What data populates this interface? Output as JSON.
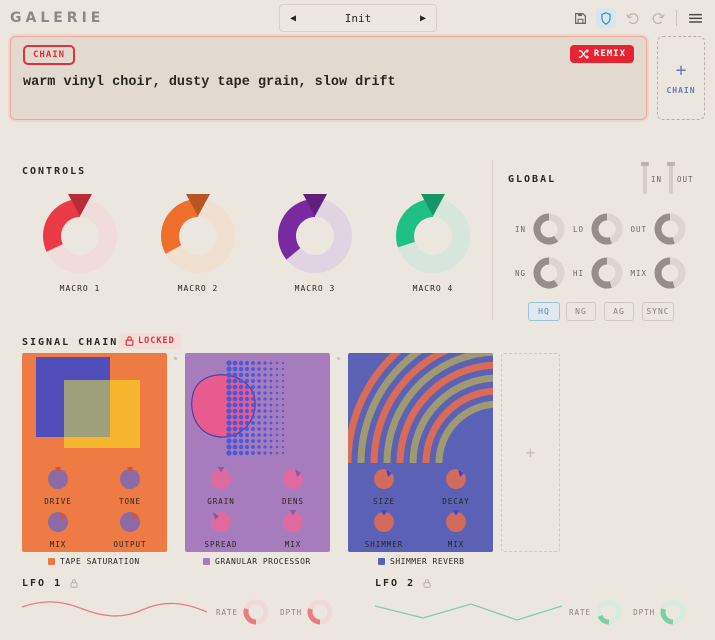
{
  "app": {
    "brand": "GALERIE"
  },
  "preset": {
    "name": "Init",
    "prev_icon": "triangle-left",
    "next_icon": "triangle-right"
  },
  "toolbar": {
    "icons": [
      "save-icon",
      "shield-icon",
      "undo-icon",
      "redo-icon",
      "menu-icon"
    ]
  },
  "prompt": {
    "tag": "CHAIN",
    "text": "warm vinyl choir, dusty tape grain, slow drift",
    "remix_label": "REMIX"
  },
  "add_chain": {
    "plus": "+",
    "label": "CHAIN"
  },
  "controls": {
    "title": "CONTROLS",
    "macros": [
      {
        "label": "MACRO 1",
        "value": 0.32,
        "color": "#ea3a47",
        "track": "#f0dcd8"
      },
      {
        "label": "MACRO 2",
        "value": 0.33,
        "color": "#ee6e2c",
        "track": "#f0e0d0"
      },
      {
        "label": "MACRO 3",
        "value": 0.36,
        "color": "#7a2aa0",
        "track": "#e0d4e2"
      },
      {
        "label": "MACRO 4",
        "value": 0.3,
        "color": "#1fbf86",
        "track": "#d6e6dc"
      }
    ]
  },
  "global": {
    "title": "GLOBAL",
    "fader_in": "IN",
    "fader_out": "OUT",
    "knobs": [
      {
        "label": "IN",
        "value": 0.6
      },
      {
        "label": "LO",
        "value": 0.55
      },
      {
        "label": "OUT",
        "value": 0.55
      },
      {
        "label": "NG",
        "value": 0.6
      },
      {
        "label": "HI",
        "value": 0.55
      },
      {
        "label": "MIX",
        "value": 0.55
      }
    ],
    "buttons": [
      {
        "label": "HQ",
        "active": true
      },
      {
        "label": "NG",
        "active": false
      },
      {
        "label": "AG",
        "active": false
      },
      {
        "label": "SYNC",
        "active": false
      }
    ]
  },
  "signal_chain": {
    "title": "SIGNAL CHAIN",
    "locked_label": "LOCKED",
    "add_label": "+",
    "modules": [
      {
        "name": "TAPE SATURATION",
        "color": "#ee7a44",
        "knobs": [
          "DRIVE",
          "TONE",
          "MIX",
          "OUTPUT"
        ]
      },
      {
        "name": "GRANULAR PROCESSOR",
        "color": "#a77cbd",
        "knobs": [
          "GRAIN",
          "DENS",
          "SPREAD",
          "MIX"
        ]
      },
      {
        "name": "SHIMMER REVERB",
        "color": "#5b62b6",
        "knobs": [
          "SIZE",
          "DECAY",
          "SHIMMER",
          "MIX"
        ]
      }
    ]
  },
  "lfo1": {
    "title": "LFO 1",
    "rate": "RATE",
    "depth": "DPTH",
    "color": "#e87c82"
  },
  "lfo2": {
    "title": "LFO 2",
    "rate": "RATE",
    "depth": "DPTH",
    "color": "#7ecfa4"
  }
}
